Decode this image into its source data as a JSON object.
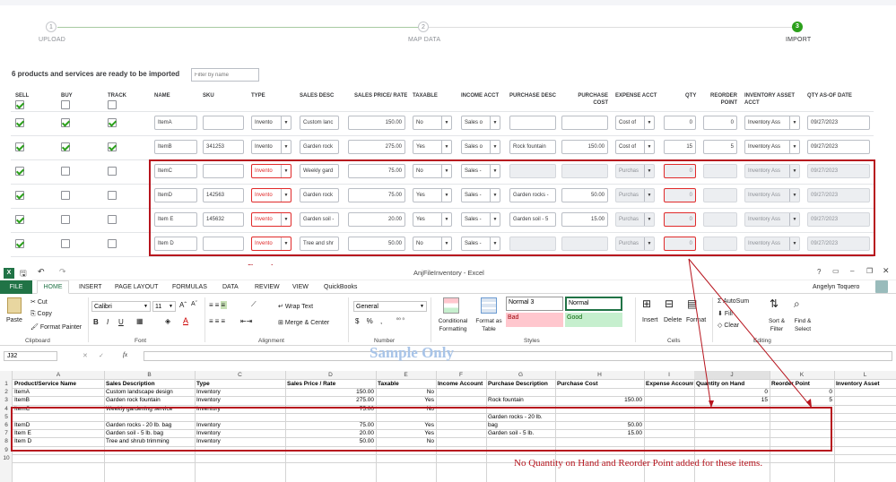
{
  "steps": [
    {
      "num": "1",
      "label": "UPLOAD"
    },
    {
      "num": "2",
      "label": "MAP DATA"
    },
    {
      "num": "3",
      "label": "IMPORT"
    }
  ],
  "import_summary": "6 products and services are ready to be imported",
  "filter_placeholder": "Filter by name",
  "columns": [
    "SELL",
    "BUY",
    "TRACK",
    "NAME",
    "SKU",
    "TYPE",
    "SALES DESC",
    "SALES PRICE/ RATE",
    "TAXABLE",
    "INCOME ACCT",
    "PURCHASE DESC",
    "PURCHASE COST",
    "EXPENSE ACCT",
    "QTY",
    "REORDER POINT",
    "INVENTORY ASSET ACCT",
    "QTY AS-OF DATE"
  ],
  "rows": [
    {
      "sell": true,
      "buy": true,
      "track": true,
      "name": "ItemA",
      "sku": "",
      "type": "Invento",
      "sales_desc": "Custom lanc",
      "price": "150.00",
      "taxable": "No",
      "income": "Sales o",
      "purch_desc": "",
      "purch_cost": "",
      "expense": "Cost of",
      "qty": "0",
      "reorder": "0",
      "asset": "Inventory Ass",
      "date": "09/27/2023",
      "error": false
    },
    {
      "sell": true,
      "buy": true,
      "track": true,
      "name": "ItemB",
      "sku": "341253",
      "type": "Invento",
      "sales_desc": "Garden rock",
      "price": "275.00",
      "taxable": "Yes",
      "income": "Sales o",
      "purch_desc": "Rock fountain",
      "purch_cost": "150.00",
      "expense": "Cost of",
      "qty": "15",
      "reorder": "5",
      "asset": "Inventory Ass",
      "date": "09/27/2023",
      "error": false
    },
    {
      "sell": true,
      "buy": false,
      "track": false,
      "name": "ItemC",
      "sku": "",
      "type": "Invento",
      "sales_desc": "Weekly gard",
      "price": "75.00",
      "taxable": "No",
      "income": "Sales -",
      "purch_desc": "",
      "purch_cost": "",
      "expense": "Purchas",
      "qty": "0",
      "reorder": "",
      "asset": "Inventory Ass",
      "date": "09/27/2023",
      "error": true
    },
    {
      "sell": true,
      "buy": false,
      "track": false,
      "name": "ItemD",
      "sku": "142563",
      "type": "Invento",
      "sales_desc": "Garden rock",
      "price": "75.00",
      "taxable": "Yes",
      "income": "Sales -",
      "purch_desc": "Garden rocks -",
      "purch_cost": "50.00",
      "expense": "Purchas",
      "qty": "0",
      "reorder": "",
      "asset": "Inventory Ass",
      "date": "09/27/2023",
      "error": true
    },
    {
      "sell": true,
      "buy": false,
      "track": false,
      "name": "Item E",
      "sku": "145632",
      "type": "Invento",
      "sales_desc": "Garden soil -",
      "price": "20.00",
      "taxable": "Yes",
      "income": "Sales -",
      "purch_desc": "Garden soil - 5",
      "purch_cost": "15.00",
      "expense": "Purchas",
      "qty": "0",
      "reorder": "",
      "asset": "Inventory Ass",
      "date": "09/27/2023",
      "error": true
    },
    {
      "sell": true,
      "buy": false,
      "track": false,
      "name": "Item D",
      "sku": "",
      "type": "Invento",
      "sales_desc": "Tree and shr",
      "price": "50.00",
      "taxable": "No",
      "income": "Sales -",
      "purch_desc": "",
      "purch_cost": "",
      "expense": "Purchas",
      "qty": "0",
      "reorder": "",
      "asset": "Inventory Ass",
      "date": "09/27/2023",
      "error": true
    }
  ],
  "annotation_error": "Error happens.",
  "annotation_missing": "No Quantity on Hand and Reorder Point added for these items.",
  "excel": {
    "title": "AnjFileInventory - Excel",
    "user": "Angelyn Toquero",
    "tabs": [
      "FILE",
      "HOME",
      "INSERT",
      "PAGE LAYOUT",
      "FORMULAS",
      "DATA",
      "REVIEW",
      "VIEW",
      "QuickBooks"
    ],
    "clipboard": {
      "paste": "Paste",
      "cut": "Cut",
      "copy": "Copy",
      "painter": "Format Painter",
      "group": "Clipboard"
    },
    "font": {
      "name": "Calibri",
      "size": "11",
      "bold": "B",
      "italic": "I",
      "underline": "U",
      "group": "Font"
    },
    "alignment": {
      "wrap": "Wrap Text",
      "merge": "Merge & Center",
      "group": "Alignment"
    },
    "number": {
      "format": "General",
      "group": "Number"
    },
    "styles": {
      "cond": "Conditional Formatting",
      "table": "Format as Table",
      "normal3": "Normal 3",
      "normal": "Normal",
      "bad": "Bad",
      "good": "Good",
      "group": "Styles"
    },
    "cells": {
      "insert": "Insert",
      "delete": "Delete",
      "format": "Format",
      "group": "Cells"
    },
    "editing": {
      "autosum": "AutoSum",
      "fill": "Fill",
      "clear": "Clear",
      "sort": "Sort & Filter",
      "find": "Find & Select",
      "group": "Editing"
    },
    "name_box": "J32",
    "watermark": "Sample Only",
    "col_letters": [
      "A",
      "B",
      "C",
      "D",
      "E",
      "F",
      "G",
      "H",
      "I",
      "J",
      "K",
      "L"
    ],
    "headers": [
      "Product/Service Name",
      "Sales Description",
      "Type",
      "Sales Price / Rate",
      "Taxable",
      "Income Account",
      "Purchase Description",
      "Purchase Cost",
      "Expense Account",
      "Quantity on Hand",
      "Reorder Point",
      "Inventory Asset"
    ],
    "rownums": [
      "1",
      "2",
      "3",
      "4",
      "5",
      "6",
      "7",
      "8",
      "9",
      "10"
    ],
    "data": [
      [
        "ItemA",
        "Custom landscape design",
        "Inventory",
        "150.00",
        "No",
        "",
        "",
        "",
        "",
        "0",
        "0",
        ""
      ],
      [
        "ItemB",
        "Garden rock fountain",
        "Inventory",
        "275.00",
        "Yes",
        "",
        "Rock fountain",
        "150.00",
        "",
        "15",
        "5",
        ""
      ],
      [
        "ItemC",
        "Weekly gardening service",
        "Inventory",
        "75.00",
        "No",
        "",
        "",
        "",
        "",
        "",
        "",
        ""
      ],
      [
        "ItemD",
        "Garden rocks - 20 lb. bag",
        "Inventory",
        "75.00",
        "Yes",
        "",
        "Garden rocks - 20 lb.|bag",
        "50.00",
        "",
        "",
        "",
        ""
      ],
      [
        "Item E",
        "Garden soil - 5 lb. bag",
        "Inventory",
        "20.00",
        "Yes",
        "",
        "Garden soil - 5 lb.",
        "15.00",
        "",
        "",
        "",
        ""
      ],
      [
        "Item D",
        "Tree and shrub trimming",
        "Inventory",
        "50.00",
        "No",
        "",
        "",
        "",
        "",
        "",
        "",
        ""
      ]
    ]
  }
}
